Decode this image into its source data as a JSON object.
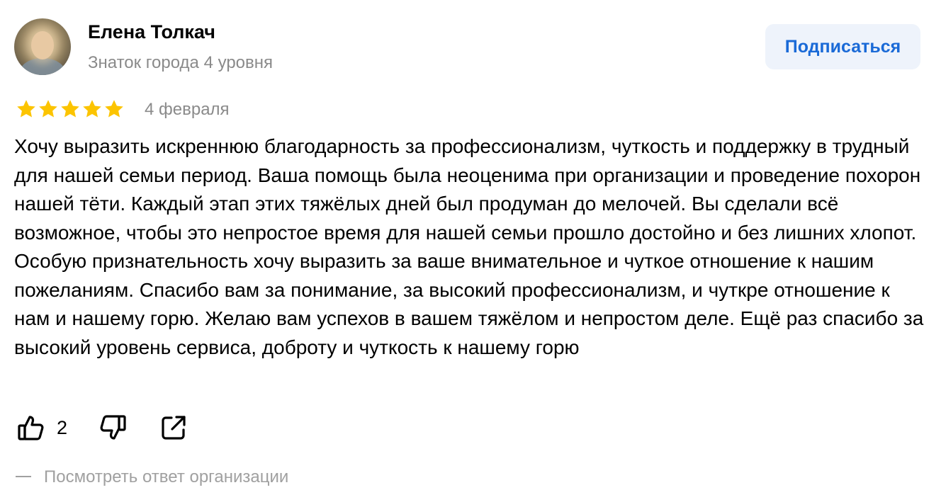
{
  "author": {
    "name": "Елена Толкач",
    "level": "Знаток города 4 уровня"
  },
  "subscribe_label": "Подписаться",
  "rating": {
    "stars": 5,
    "max": 5,
    "color": "#fcc400"
  },
  "date": "4 февраля",
  "text": "Хочу выразить искреннюю благодарность за профессионализм, чуткость и поддержку в трудный для нашей семьи период. Ваша помощь была неоценима при организации и проведение похорон нашей тёти. Каждый этап этих тяжёлых дней был продуман до мелочей. Вы сделали всё возможное, чтобы это непростое время для нашей семьи прошло достойно и без лишних хлопот. Особую признательность хочу выразить за ваше внимательное и чуткое отношение к нашим пожеланиям. Спасибо вам за понимание, за высокий профессионализм, и чуткре отношение к нам и нашему горю. Желаю вам успехов в вашем тяжёлом и непростом деле. Ещё раз спасибо за высокий уровень сервиса, доброту и чуткость к нашему горю",
  "actions": {
    "like_icon": "thumbs-up-icon",
    "like_count": "2",
    "dislike_icon": "thumbs-down-icon",
    "share_icon": "share-icon"
  },
  "org_answer_label": "Посмотреть ответ организации",
  "colors": {
    "accent": "#1a6ad7",
    "subscribe_bg": "#eef3fb",
    "muted": "#8a8a8a",
    "star": "#fcc400"
  }
}
